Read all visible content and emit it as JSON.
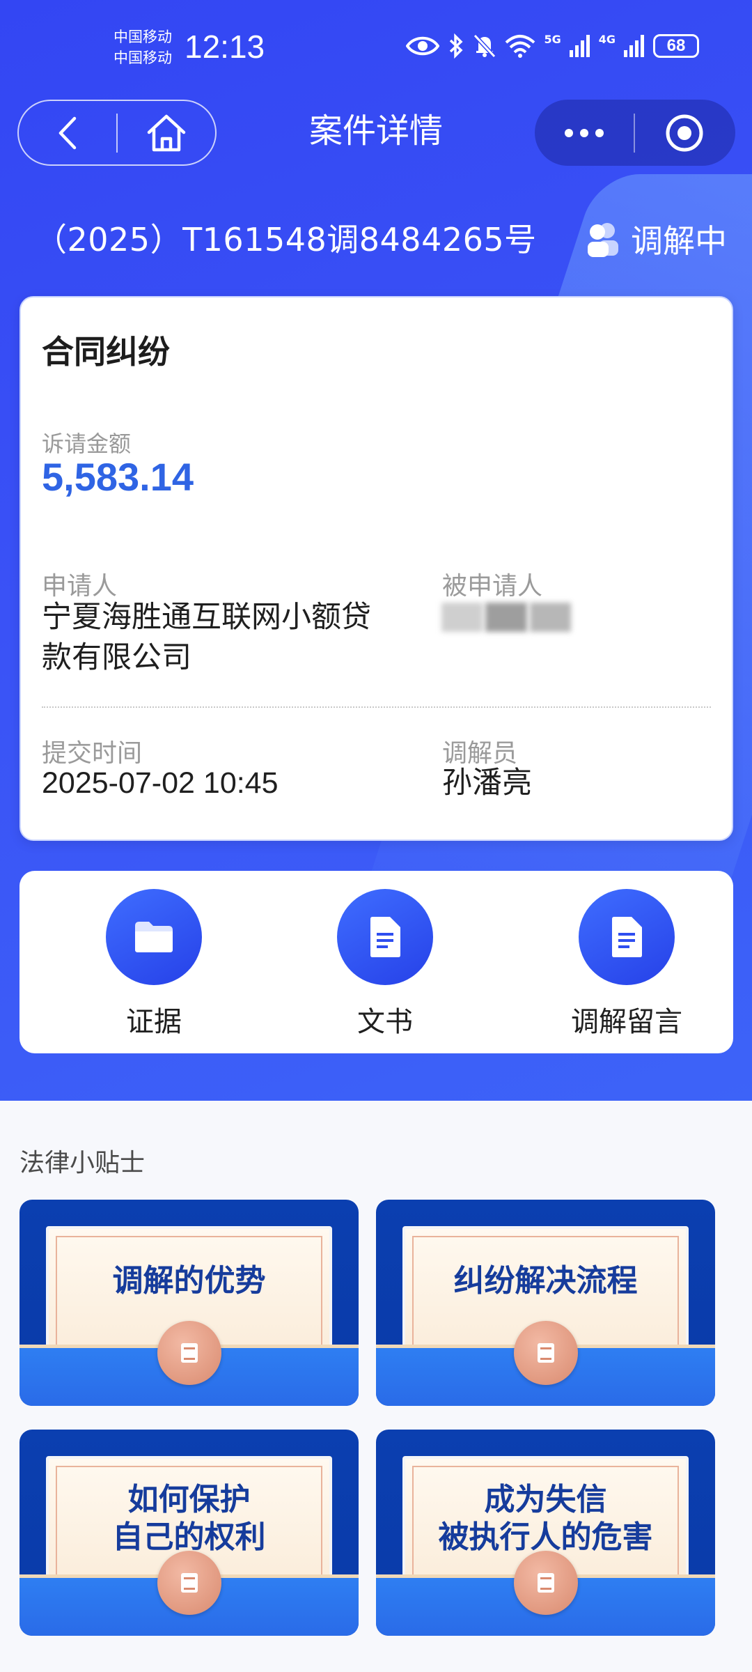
{
  "status_bar": {
    "carrier_1": "中国移动",
    "carrier_2": "中国移动",
    "time": "12:13",
    "sig1_label": "5G",
    "sig2_label": "4G",
    "battery": "68"
  },
  "nav": {
    "title": "案件详情"
  },
  "case": {
    "number": "（2025）T161548调8484265号",
    "status": "调解中"
  },
  "card": {
    "title": "合同纠纷",
    "amount_label": "诉请金额",
    "amount_value": "5,583.14",
    "applicant_label": "申请人",
    "applicant_line1": "宁夏海胜通互联网小额贷",
    "applicant_line2": "款有限公司",
    "respondent_label": "被申请人",
    "submit_time_label": "提交时间",
    "submit_time_value": "2025-07-02 10:45",
    "mediator_label": "调解员",
    "mediator_value": "孙潘亮"
  },
  "actions": [
    {
      "label": "证据",
      "icon": "folder-icon"
    },
    {
      "label": "文书",
      "icon": "document-icon"
    },
    {
      "label": "调解留言",
      "icon": "document-icon"
    }
  ],
  "tips": {
    "title": "法律小贴士",
    "items": [
      {
        "line1": "调解的优势",
        "line2": ""
      },
      {
        "line1": "纠纷解决流程",
        "line2": ""
      },
      {
        "line1": "如何保护",
        "line2": "自己的权利"
      },
      {
        "line1": "成为失信",
        "line2": "被执行人的危害"
      }
    ]
  },
  "colors": {
    "hero_blue": "#3346f3",
    "amount_blue": "#2f64e4",
    "tip_navy": "#0b3fb0"
  }
}
